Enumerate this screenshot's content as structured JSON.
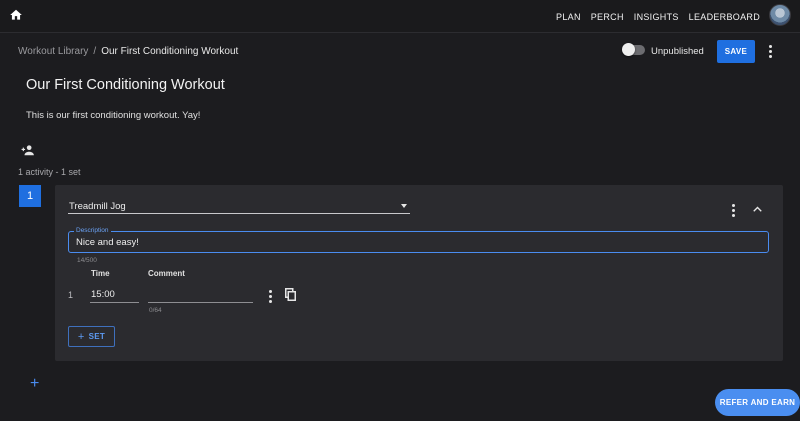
{
  "nav": {
    "items": [
      {
        "label": "PLAN"
      },
      {
        "label": "PERCH"
      },
      {
        "label": "INSIGHTS"
      },
      {
        "label": "LEADERBOARD"
      }
    ]
  },
  "breadcrumb": {
    "parent": "Workout Library",
    "separator": "/",
    "current": "Our First Conditioning Workout"
  },
  "toolbar": {
    "publish_label": "Unpublished",
    "publish_toggle_on": false,
    "save_label": "SAVE"
  },
  "workout": {
    "title": "Our First Conditioning Workout",
    "description": "This is our first conditioning workout. Yay!",
    "summary": "1 activity - 1 set"
  },
  "activity": {
    "number": "1",
    "name": "Treadmill Jog",
    "description_label": "Description",
    "description_value": "Nice and easy!",
    "description_count": "14/500",
    "columns": {
      "time": "Time",
      "comment": "Comment"
    },
    "rows": [
      {
        "index": "1",
        "time": "15:00",
        "comment": "",
        "comment_count": "0/64"
      }
    ],
    "add_set_label": "SET"
  },
  "actions": {
    "add_activity_symbol": "+",
    "refer_label": "REFER AND EARN"
  },
  "colors": {
    "accent": "#1f6fe0",
    "background": "#1c1c1f",
    "card": "#2b2b2f"
  },
  "icons": {
    "home": "home-icon",
    "add_person": "add-person-icon",
    "more": "more-vert-icon",
    "collapse": "chevron-up-icon",
    "copy": "copy-icon"
  }
}
